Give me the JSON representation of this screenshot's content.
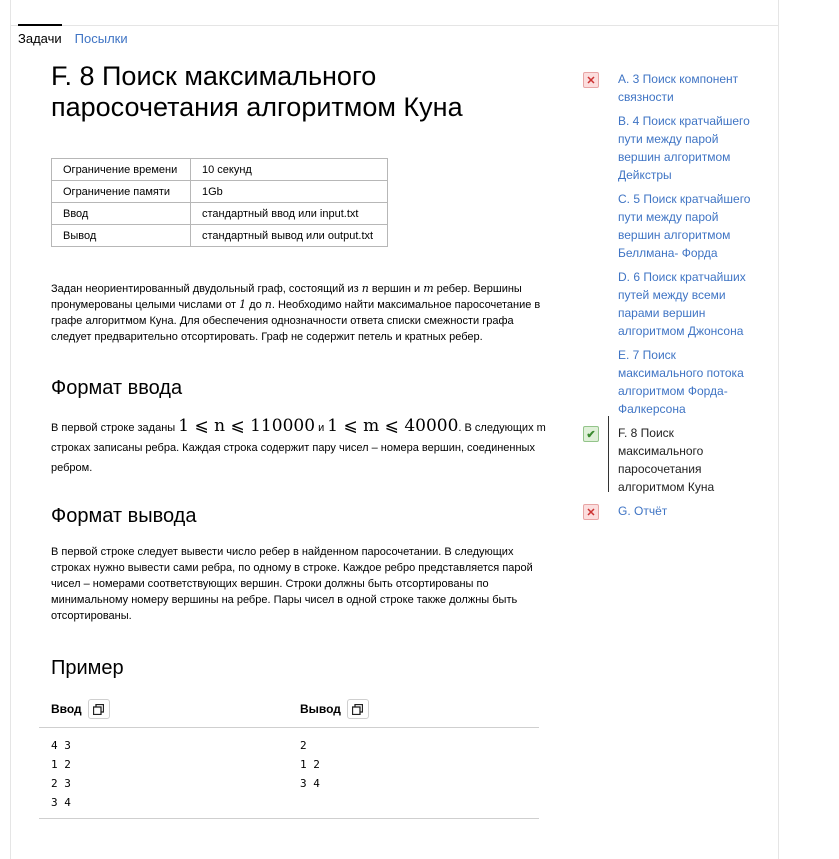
{
  "tabs": {
    "problems": "Задачи",
    "submissions": "Посылки"
  },
  "problem": {
    "title": "F. 8 Поиск максимального паросочетания алгоритмом Куна",
    "limits": [
      {
        "label": "Ограничение времени",
        "value": "10 секунд"
      },
      {
        "label": "Ограничение памяти",
        "value": "1Gb"
      },
      {
        "label": "Ввод",
        "value": "стандартный ввод или input.txt"
      },
      {
        "label": "Вывод",
        "value": "стандартный вывод или output.txt"
      }
    ],
    "legend": {
      "p1": "Задан неориентированный двудольный граф, состоящий из ",
      "n": "n",
      "p2": " вершин и ",
      "m": "m",
      "p3": " ребер. Вершины пронумерованы целыми числами от ",
      "one": "1",
      "p4": " до ",
      "n2": "n",
      "p5": ". Необходимо найти максимальное паросочетание в графе алгоритмом Куна. Для обеспечения однозначности ответа списки смежности графа следует предварительно отсортировать. Граф не содержит петель и кратных ребер."
    },
    "input_format": {
      "heading": "Формат ввода",
      "p1": "В первой строке заданы ",
      "math1": "1 ⩽ n ⩽ 110000",
      "and": " и ",
      "math2": "1 ⩽ m ⩽ 40000",
      "p2": ". В следующих m строках записаны ребра. Каждая строка содержит пару чисел – номера вершин, соединенных ребром."
    },
    "output_format": {
      "heading": "Формат вывода",
      "text": "В первой строке следует вывести число ребер в найденном паросочетании. В следующих строках нужно вывести сами ребра, по одному в строке. Каждое ребро представляется парой чисел – номерами соответствующих вершин. Строки должны быть отсортированы по минимальному номеру вершины на ребре. Пары чисел в одной строке также должны быть отсортированы."
    },
    "example": {
      "heading": "Пример",
      "input_label": "Ввод",
      "output_label": "Вывод",
      "input": "4 3\n1 2\n2 3\n3 4",
      "output": "2\n1 2\n3 4"
    }
  },
  "sidebar": {
    "items": [
      {
        "label": "A. 3 Поиск компонент связности",
        "status": "fail",
        "mark": "✕"
      },
      {
        "label": "B. 4 Поиск кратчайшего пути между парой вершин алгоритмом Дейкстры",
        "status": "none"
      },
      {
        "label": "C. 5 Поиск кратчайшего пути между парой вершин алгоритмом Беллмана- Форда",
        "status": "none"
      },
      {
        "label": "D. 6 Поиск кратчайших путей между всеми парами вершин алгоритмом Джонсона",
        "status": "none"
      },
      {
        "label": "E. 7 Поиск максимального потока алгоритмом Форда-Фалкерсона",
        "status": "none"
      },
      {
        "label": "F. 8 Поиск максимального паросочетания алгоритмом Куна",
        "status": "ok",
        "mark": "✔"
      },
      {
        "label": "G. Отчёт",
        "status": "fail",
        "mark": "✕"
      }
    ]
  },
  "colors": {
    "link": "#3f74c4",
    "fail": "#c33",
    "ok": "#3a8a2f"
  }
}
